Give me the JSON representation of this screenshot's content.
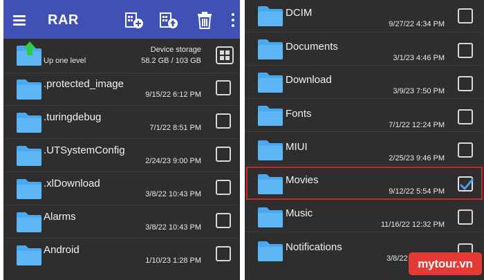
{
  "app": {
    "title": "RAR"
  },
  "left": {
    "up_level_label": "Up one level",
    "storage_label": "Device storage",
    "storage_size": "58.2 GB / 103 GB",
    "rows": [
      {
        "name": ".protected_image",
        "date": "9/15/22 6:12 PM"
      },
      {
        "name": ".turingdebug",
        "date": "7/1/22 8:51 PM"
      },
      {
        "name": ".UTSystemConfig",
        "date": "2/24/23 9:00 PM"
      },
      {
        "name": ".xlDownload",
        "date": "3/8/22 10:43 PM"
      },
      {
        "name": "Alarms",
        "date": "3/8/22 10:43 PM"
      },
      {
        "name": "Android",
        "date": "1/10/23 1:28 PM"
      }
    ]
  },
  "right": {
    "rows": [
      {
        "name": "DCIM",
        "date": "9/27/22 4:34 PM",
        "checked": false
      },
      {
        "name": "Documents",
        "date": "3/1/23 4:46 PM",
        "checked": false
      },
      {
        "name": "Download",
        "date": "3/9/23 7:50 PM",
        "checked": false
      },
      {
        "name": "Fonts",
        "date": "7/1/22 12:24 PM",
        "checked": false
      },
      {
        "name": "MIUI",
        "date": "2/25/23 9:46 PM",
        "checked": false
      },
      {
        "name": "Movies",
        "date": "9/12/22 5:54 PM",
        "checked": true
      },
      {
        "name": "Music",
        "date": "11/16/22 12:32 PM",
        "checked": false
      },
      {
        "name": "Notifications",
        "date": "3/8/22",
        "checked": false
      }
    ]
  },
  "watermark": "mytour.vn",
  "colors": {
    "toolbar": "#3f51b5",
    "background": "#2e2e2e",
    "folder": "#4aa8f0",
    "highlight": "#c62828",
    "check": "#4a9be8",
    "up_arrow": "#2ecc40",
    "watermark": "#e53935"
  },
  "icons": {
    "menu": "hamburger-icon",
    "add_archive": "add-archive-icon",
    "extract_archive": "extract-archive-icon",
    "delete": "trash-icon",
    "more": "more-vertical-icon",
    "grid": "grid-view-icon",
    "folder": "folder-icon"
  }
}
